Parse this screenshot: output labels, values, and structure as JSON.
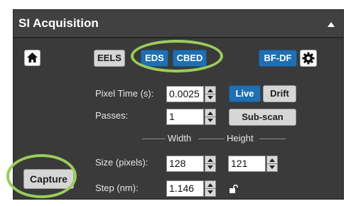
{
  "panel": {
    "title": "SI Acquisition"
  },
  "toolbar": {
    "home_icon": "home-icon",
    "eels_label": "EELS",
    "eds_label": "EDS",
    "cbed_label": "CBED",
    "bfdf_label": "BF-DF",
    "settings_icon": "gear-icon"
  },
  "fields": {
    "pixel_time_label": "Pixel Time (s):",
    "pixel_time_value": "0.0025",
    "passes_label": "Passes:",
    "passes_value": "1",
    "width_header": "Width",
    "height_header": "Height",
    "size_label": "Size (pixels):",
    "size_width": "128",
    "size_height": "121",
    "step_label": "Step (nm):",
    "step_value": "1.146"
  },
  "buttons": {
    "live_label": "Live",
    "drift_label": "Drift",
    "subscan_label": "Sub-scan",
    "capture_label": "Capture"
  },
  "colors": {
    "panel_bg": "#3a3a3a",
    "accent_blue": "#1f6fb2",
    "highlight_ring": "#9acd5a"
  }
}
